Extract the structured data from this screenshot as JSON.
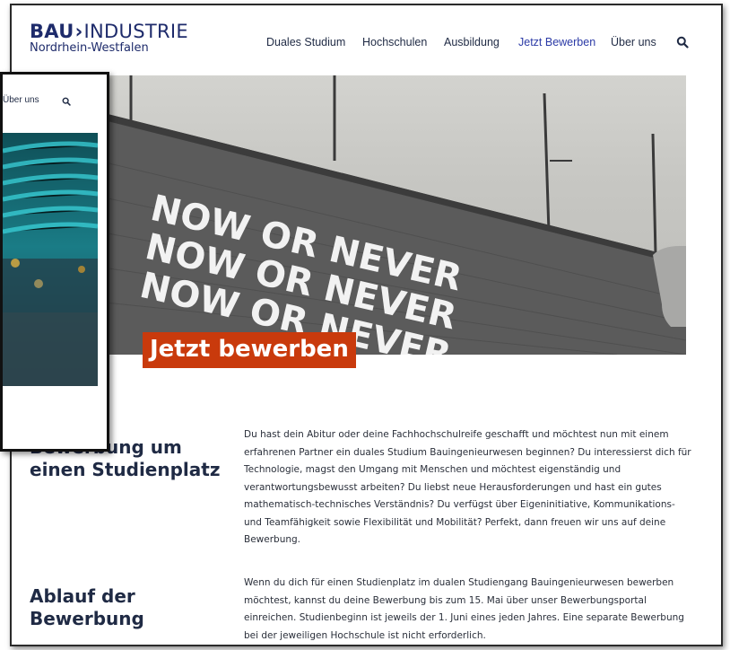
{
  "logo": {
    "brand_bold": "BAU",
    "brand_chevron": "›",
    "brand_rest": "INDUSTRIE",
    "region": "Nordrhein-Westfalen"
  },
  "nav": {
    "items": [
      {
        "label": "Duales Studium"
      },
      {
        "label": "Hochschulen"
      },
      {
        "label": "Ausbildung"
      },
      {
        "label": "Jetzt Bewerben",
        "active": true
      },
      {
        "label": "Über uns"
      }
    ],
    "search_icon": "search-icon"
  },
  "hero": {
    "wall_text": [
      "NOW OR NEVER",
      "NOW OR NEVER",
      "NOW OR NEVER"
    ],
    "heading": "Jetzt bewerben"
  },
  "sections": [
    {
      "heading_line1": "Bewerbung um",
      "heading_line2": "einen Studienplatz",
      "text": "Du hast dein Abitur oder deine Fachhochschulreife geschafft und möchtest nun mit einem erfahrenen Partner ein duales Studium Bauingenieurwesen beginnen? Du interessierst dich für Technologie, magst den Umgang mit Menschen und möchtest eigenständig und verantwortungsbewusst arbeiten? Du liebst neue Herausforderungen und hast ein gutes mathematisch-technisches Verständnis? Du verfügst über Eigeninitiative, Kommunikations- und Teamfähigkeit sowie Flexibilität und Mobilität? Perfekt, dann freuen wir uns auf deine Bewerbung."
    },
    {
      "heading_line1": "Ablauf der",
      "heading_line2": "Bewerbung",
      "text": "Wenn du dich für einen Studienplatz im dualen Studiengang Bauingenieurwesen bewerben möchtest, kannst du deine Bewerbung bis zum 15. Mai über unser Bewerbungsportal einreichen. Studienbeginn ist jeweils der 1. Juni eines jeden Jahres. Eine separate Bewerbung bei der jeweiligen Hochschule ist nicht erforderlich."
    }
  ],
  "overlay": {
    "nav_label": "Über uns"
  },
  "colors": {
    "brand_blue": "#1e2b6b",
    "nav_active": "#2b3aa6",
    "heading_bg": "#c93a0c"
  }
}
